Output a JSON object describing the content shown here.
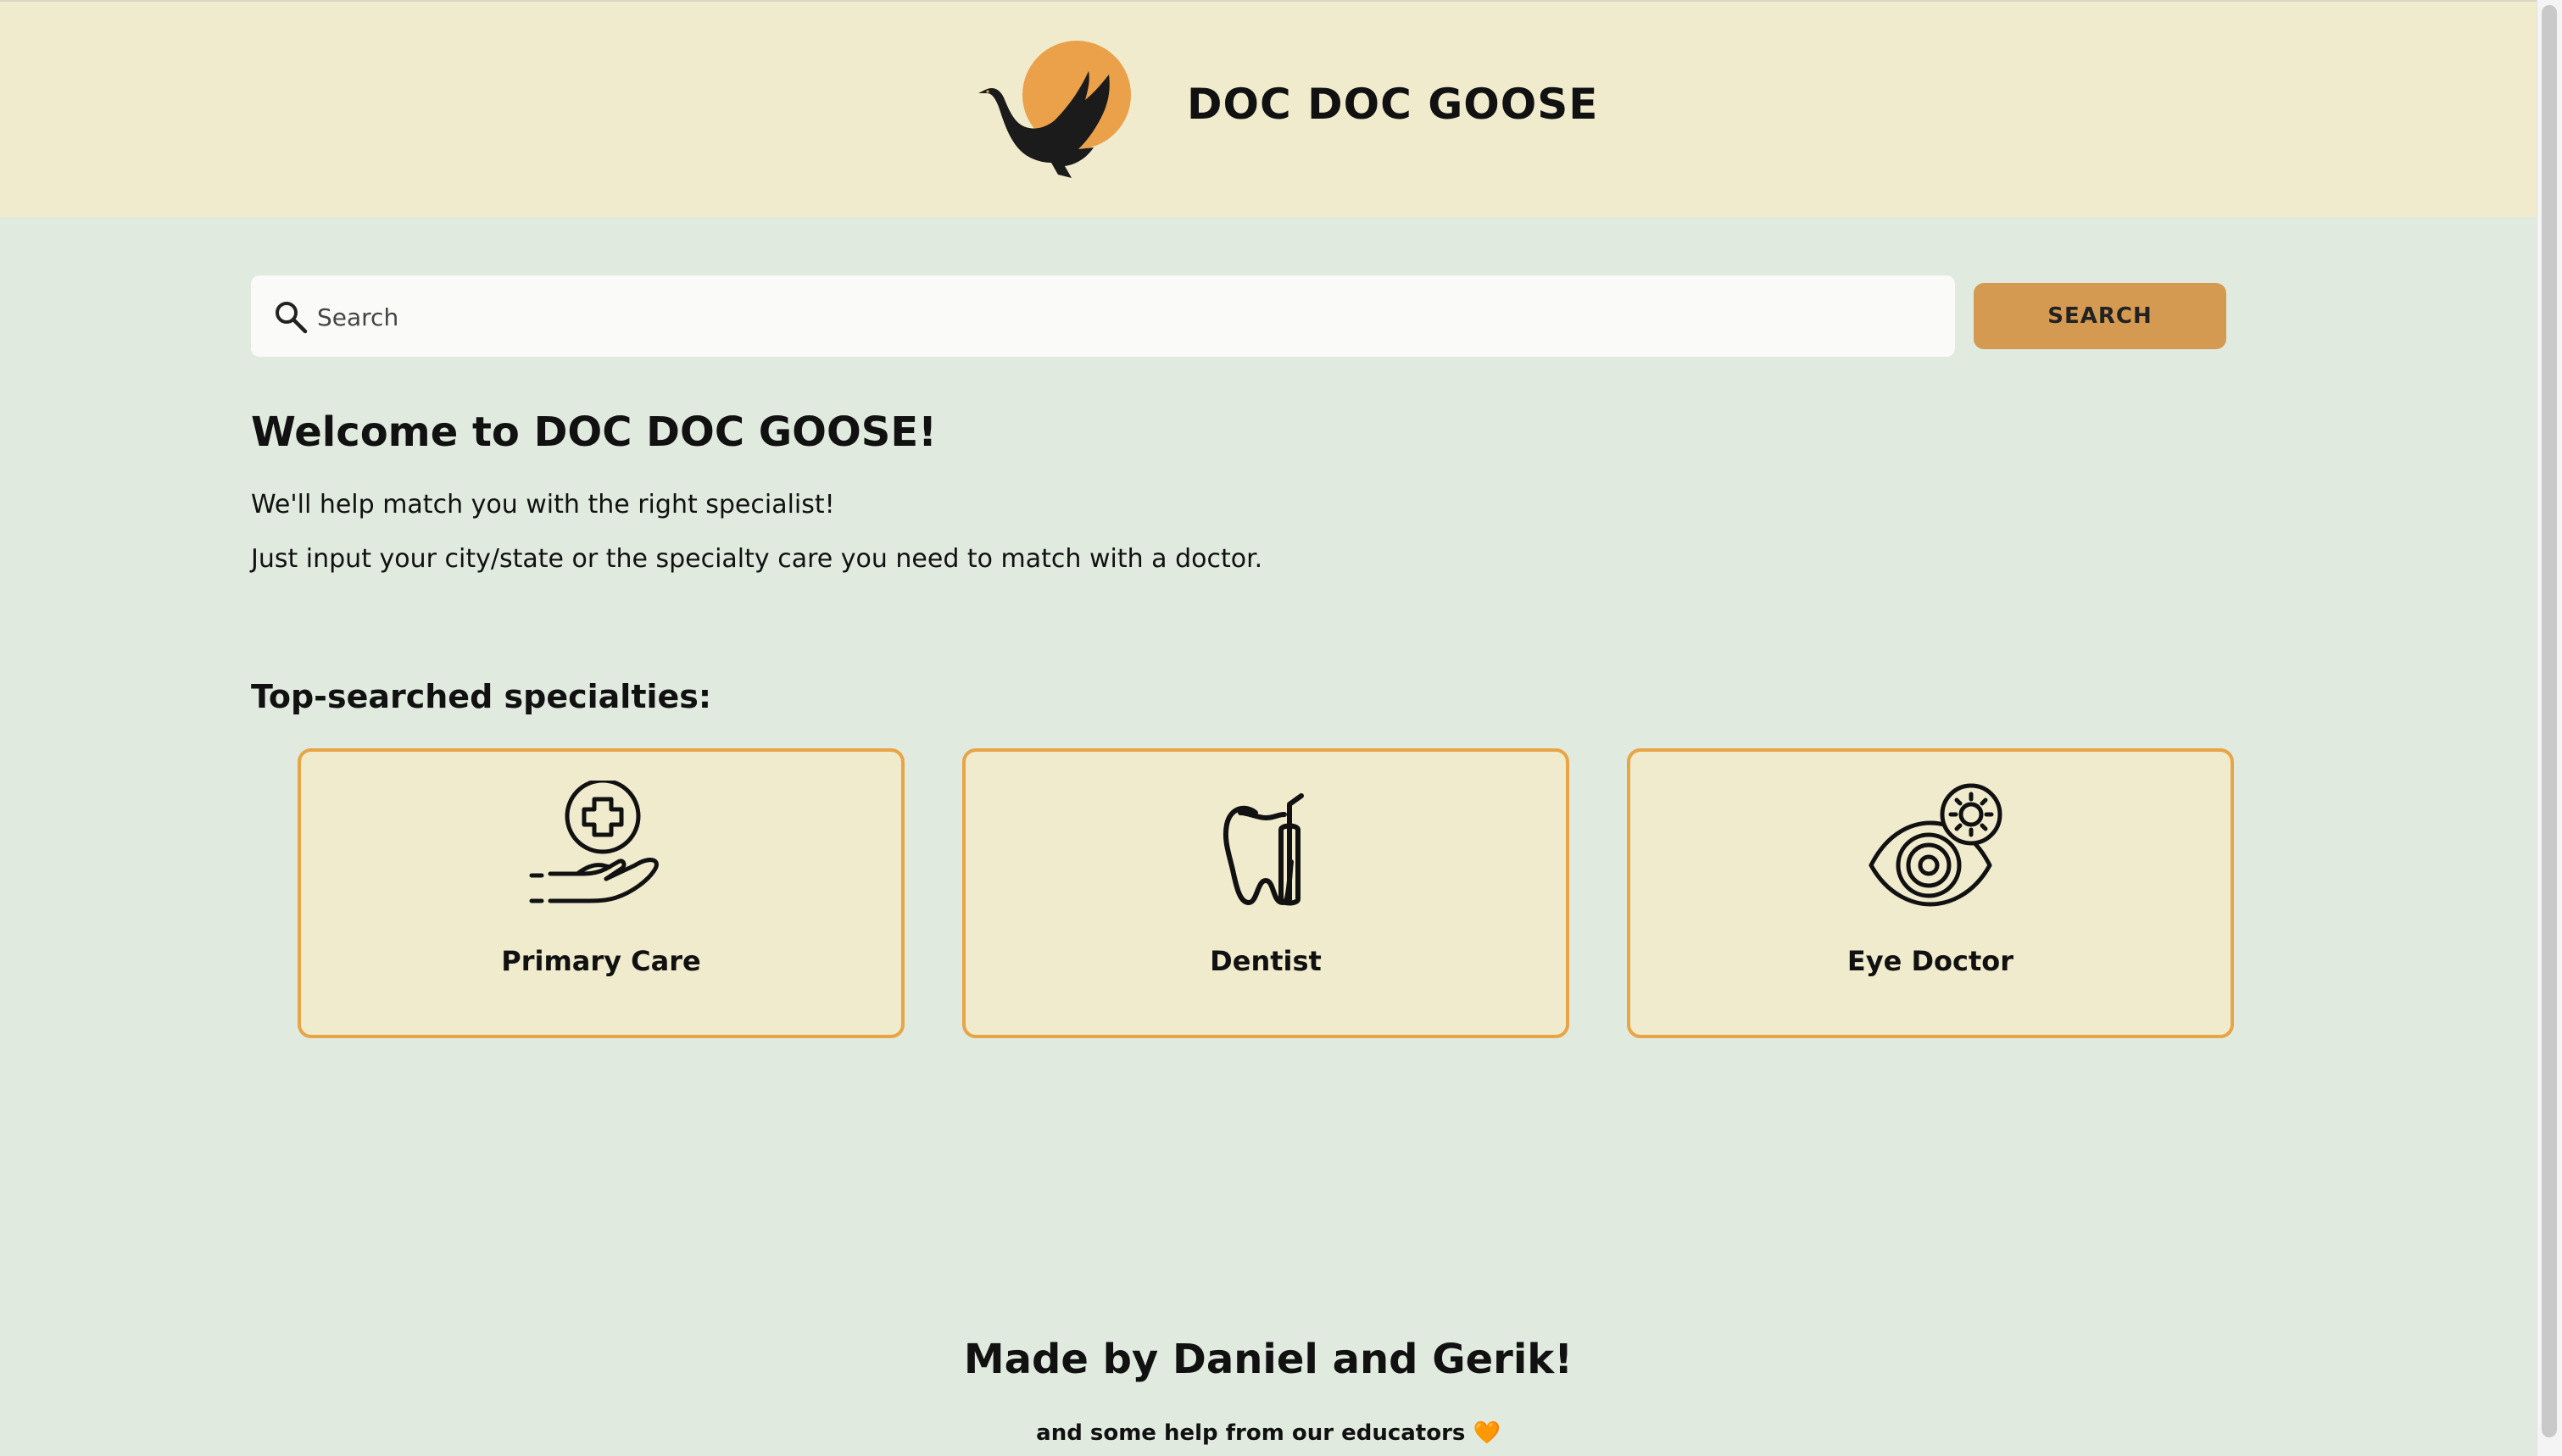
{
  "header": {
    "brand": "DOC DOC GOOSE",
    "logo_icon": "goose-sun-logo",
    "accent_color": "#eba04a",
    "background": "#f0ebcd"
  },
  "search": {
    "placeholder": "Search",
    "button_label": "SEARCH",
    "button_color": "#d59a52"
  },
  "welcome": {
    "title": "Welcome to DOC DOC GOOSE!",
    "line1": "We'll help match you with the right specialist!",
    "line2": "Just input your city/state or the specialty care you need to match with a doctor."
  },
  "specialties": {
    "title": "Top-searched specialties:",
    "items": [
      {
        "label": "Primary Care",
        "icon": "hand-medical-cross-icon"
      },
      {
        "label": "Dentist",
        "icon": "tooth-icon"
      },
      {
        "label": "Eye Doctor",
        "icon": "eye-lens-icon"
      }
    ],
    "card_border_color": "#e8a445"
  },
  "footer": {
    "title": "Made by Daniel and Gerik!",
    "subtitle": "and some help from our educators 🧡"
  },
  "page_background": "#e0eadf"
}
